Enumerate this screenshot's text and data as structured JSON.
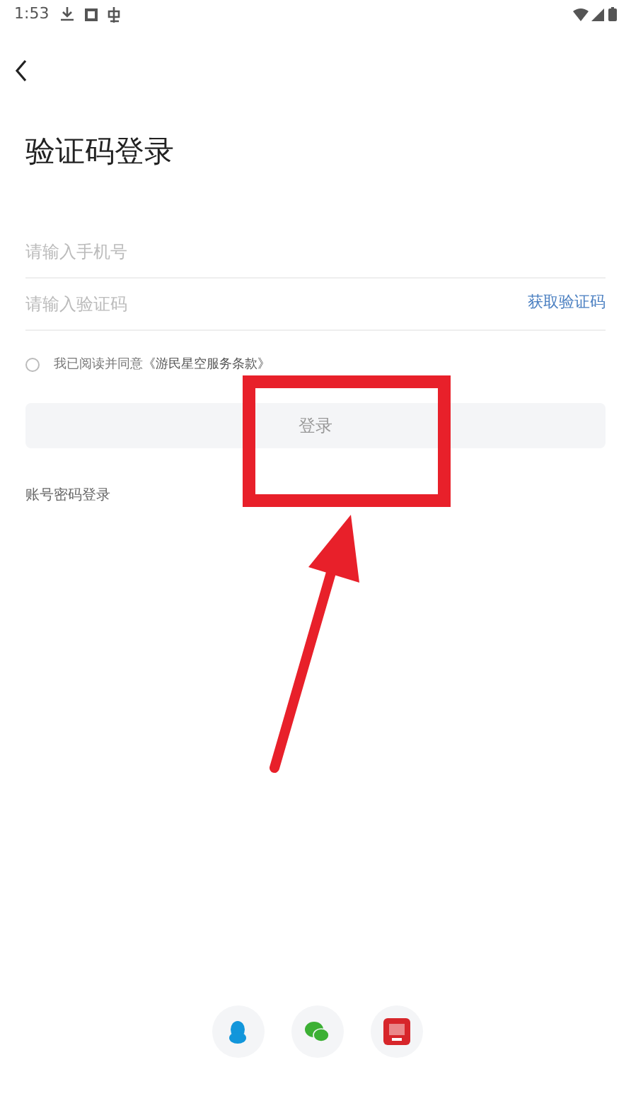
{
  "status_bar": {
    "time": "1:53"
  },
  "title": "验证码登录",
  "fields": [
    {
      "placeholder": "请输入手机号"
    },
    {
      "placeholder": "请输入验证码",
      "action": "获取验证码"
    }
  ],
  "agreement": {
    "checked": false,
    "text": "我已阅读并同意",
    "link": "《游民星空服务条款》"
  },
  "login_button": {
    "label": "登录",
    "disabled": true
  },
  "alt_login": "账号密码登录"
}
